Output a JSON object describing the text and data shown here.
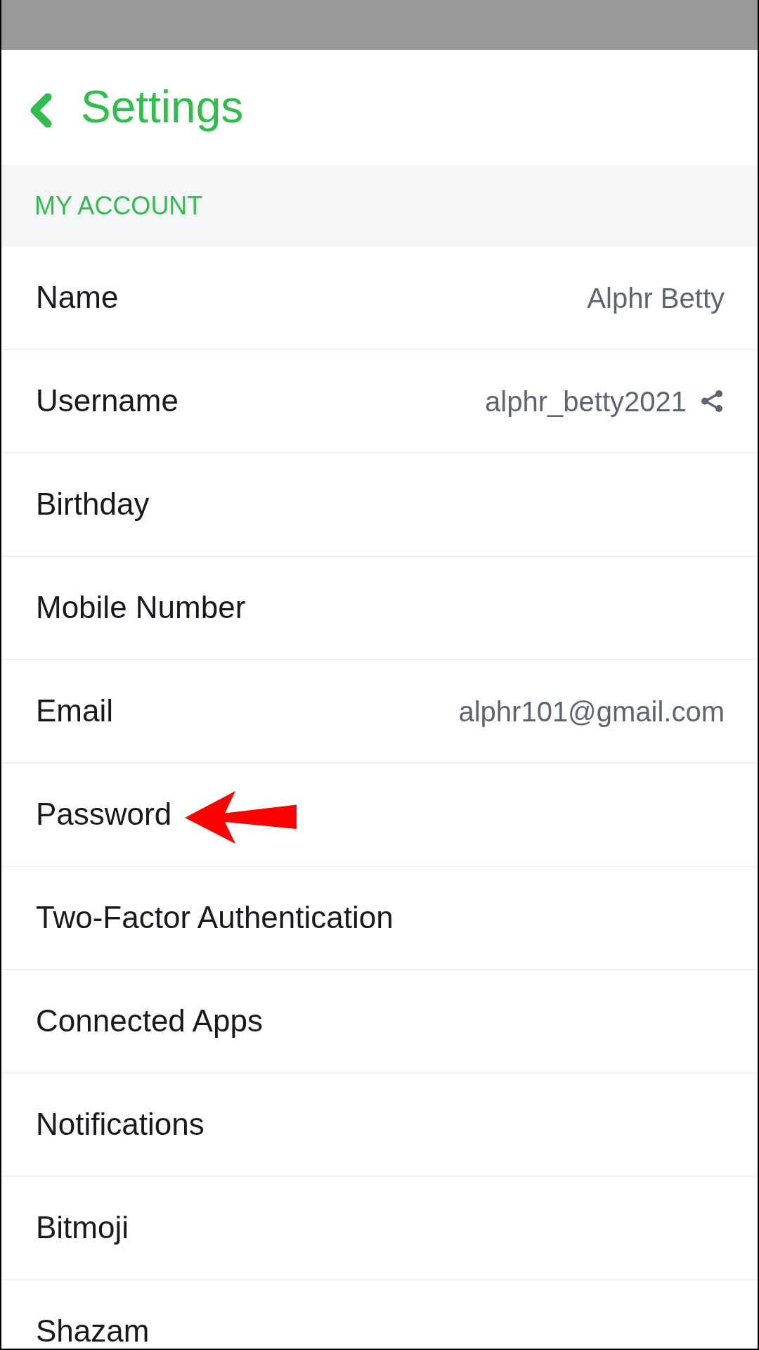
{
  "header": {
    "title": "Settings"
  },
  "section": {
    "title": "MY ACCOUNT"
  },
  "rows": [
    {
      "label": "Name",
      "value": "Alphr Betty",
      "share": false,
      "annotated": false
    },
    {
      "label": "Username",
      "value": "alphr_betty2021",
      "share": true,
      "annotated": false
    },
    {
      "label": "Birthday",
      "share": false,
      "annotated": false
    },
    {
      "label": "Mobile Number",
      "share": false,
      "annotated": false
    },
    {
      "label": "Email",
      "value": "alphr101@gmail.com",
      "share": false,
      "annotated": false
    },
    {
      "label": "Password",
      "share": false,
      "annotated": true
    },
    {
      "label": "Two-Factor Authentication",
      "share": false,
      "annotated": false
    },
    {
      "label": "Connected Apps",
      "share": false,
      "annotated": false
    },
    {
      "label": "Notifications",
      "share": false,
      "annotated": false
    },
    {
      "label": "Bitmoji",
      "share": false,
      "annotated": false
    },
    {
      "label": "Shazam",
      "share": false,
      "annotated": false
    }
  ]
}
